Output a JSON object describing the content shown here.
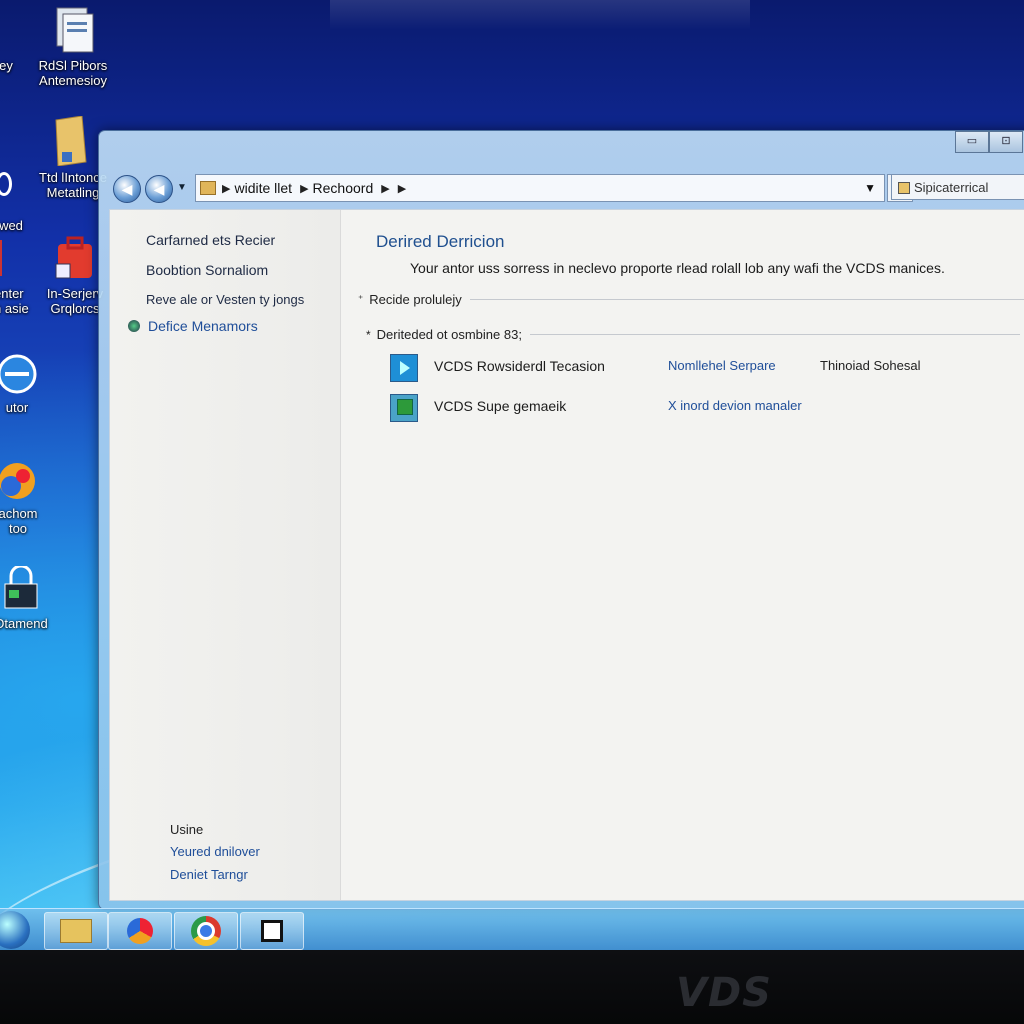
{
  "desktop_icons": [
    {
      "label": "RdSl Pibors Antemesioy",
      "icon": "document-stack-icon"
    },
    {
      "label": "Ttd lIntonce Metatling",
      "icon": "folder-icon"
    },
    {
      "label": "In-Serjerv Grqlorcs",
      "icon": "red-package-icon"
    },
    {
      "label": "utor",
      "icon": "internet-explorer-icon"
    },
    {
      "label": "achom too",
      "icon": "media-player-icon"
    },
    {
      "label": "Otamend",
      "icon": "network-lock-icon"
    }
  ],
  "desktop_edge_labels": {
    "a": "ey",
    "b": "wed",
    "c": "enter n asie"
  },
  "window": {
    "controls": {
      "minimize": "▭",
      "close": "⊡"
    },
    "address": {
      "crumb1": "widite llet",
      "crumb2": "Rechoord"
    },
    "search_placeholder": "Sipicaterrical"
  },
  "left_pane": {
    "items": [
      "Carfarned ets Recier",
      "Boobtion Sornaliom",
      "Reve ale or Vesten ty jongs",
      "Defice Menamors"
    ],
    "footer_title": "Usine",
    "footer_links": [
      "Yeured dnilover",
      "Deniet Tarngr"
    ]
  },
  "main": {
    "title": "Derired Derricion",
    "description": "Your antor uss sorress in neclevo proporte rlead rolall lob any wafi the VCDS manices.",
    "group1": "Recide prolulejy",
    "group2": "Deriteded ot osmbine 83;",
    "rows": [
      {
        "name": "VCDS Rowsiderdl Tecasion",
        "col2": "Nomllehel Serpare",
        "col3": "Thinoiad Sohesal",
        "icon": "play-app-icon",
        "color": "#1e8fd6"
      },
      {
        "name": "VCDS Supe gemaeik",
        "col2": "X inord devion manaler",
        "col3": "",
        "icon": "chip-app-icon",
        "color": "#2d9a3a"
      }
    ]
  },
  "taskbar": {
    "items": [
      "start-orb-icon",
      "explorer-icon",
      "media-icon",
      "chrome-icon",
      "app-window-icon"
    ]
  },
  "monitor": {
    "brand": "VDS"
  }
}
